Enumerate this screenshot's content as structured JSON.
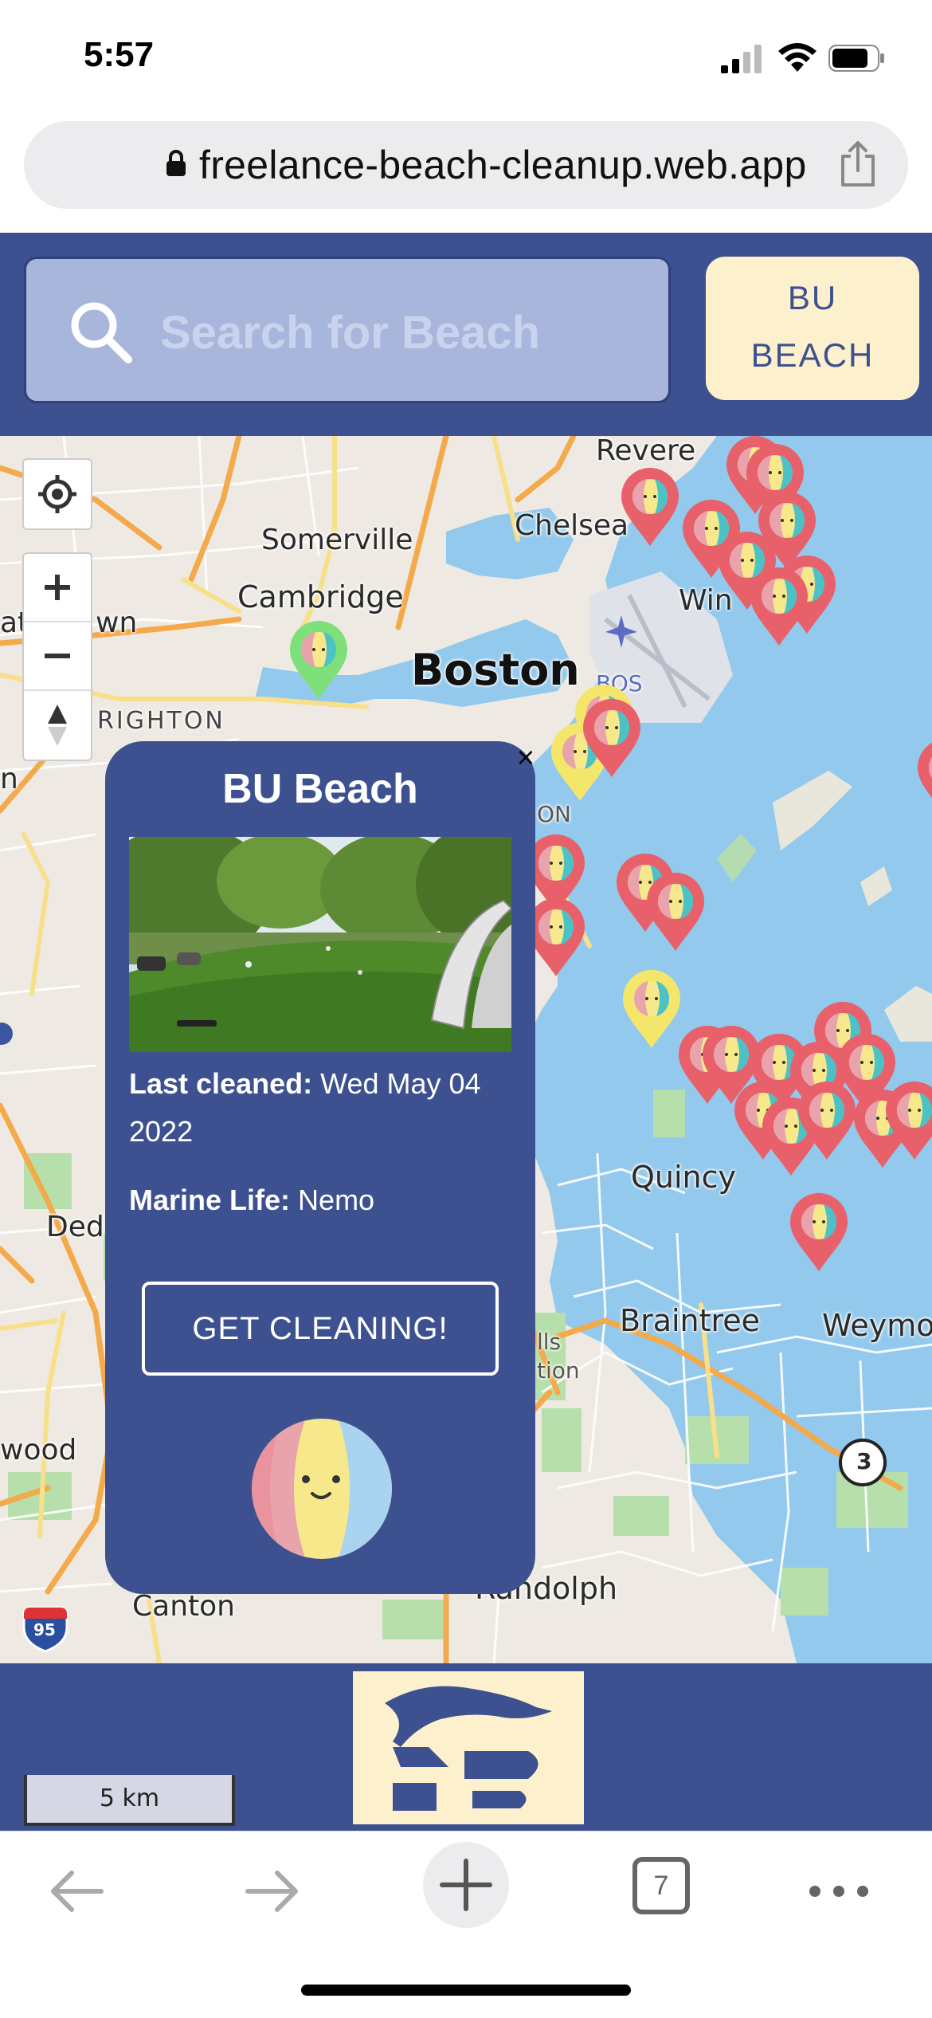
{
  "status_bar": {
    "time": "5:57"
  },
  "browser": {
    "url": "freelance-beach-cleanup.web.app",
    "tab_count": "7"
  },
  "header": {
    "search_placeholder": "Search for Beach",
    "beach_button_line1": "BU",
    "beach_button_line2": "BEACH"
  },
  "map": {
    "labels": {
      "revere": "Revere",
      "chelsea": "Chelsea",
      "somerville": "Somerville",
      "cambridge": "Cambridge",
      "boston": "Boston",
      "bos": "BOS",
      "brighton": "RIGHTON",
      "watertown": "at",
      "watertown2": "wn",
      "winthrop": "Win",
      "quincy": "Quincy",
      "dedham": "Ded",
      "braintree": "Braintree",
      "weymouth": "Weymo",
      "norwood": "wood",
      "canton": "Canton",
      "randolph": "Randolph",
      "hills": "lls",
      "station": "tion",
      "on": "ON",
      "n_left": "n",
      "route3": "3",
      "interstate95": "95"
    },
    "scale": "5 km",
    "marker_colors": {
      "dirty": "#e8606a",
      "clean": "#7ee07a",
      "moderate": "#f4e66a"
    }
  },
  "popup": {
    "title": "BU Beach",
    "last_cleaned_label": "Last cleaned:",
    "last_cleaned_value": "Wed May 04 2022",
    "marine_life_label": "Marine Life:",
    "marine_life_value": "Nemo",
    "button_label": "GET CLEANING!",
    "close": "×"
  },
  "colors": {
    "brand_blue": "#3d5190",
    "cream": "#fdf1cd",
    "search_bg": "#a8b6dc"
  }
}
